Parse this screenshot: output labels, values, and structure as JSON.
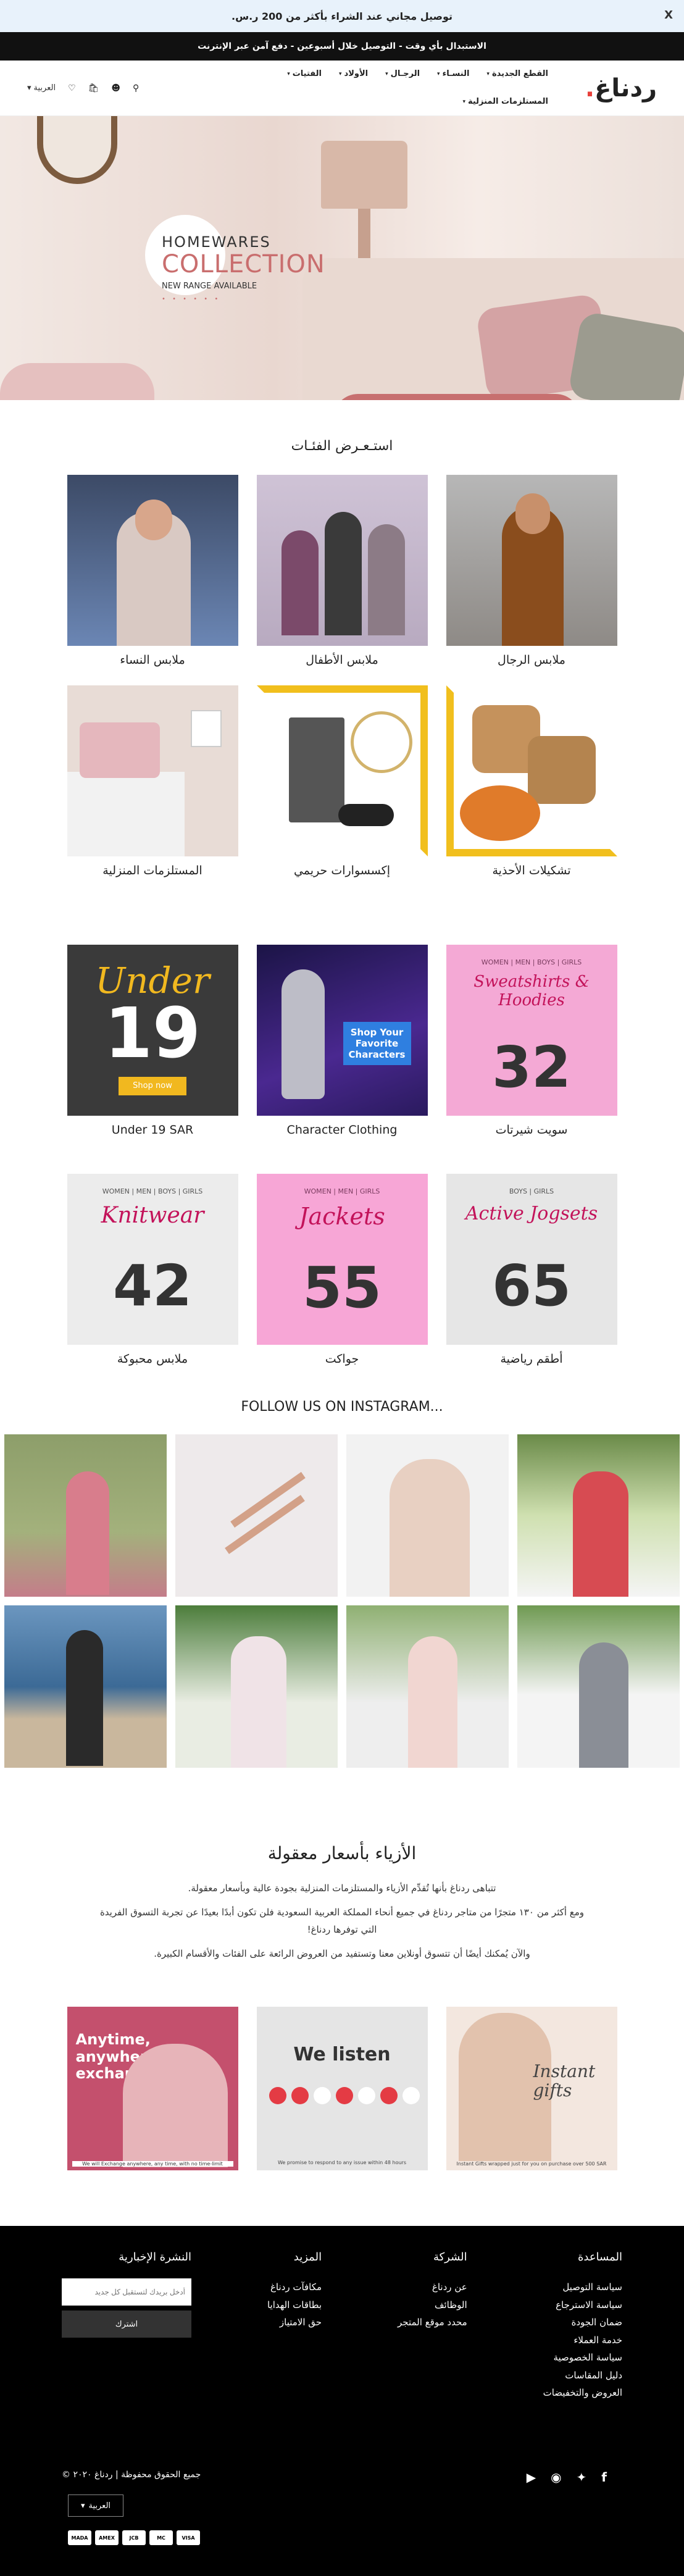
{
  "announcement": {
    "text": "توصيل مجاني عند الشراء بأكثر من 200 ر.س.",
    "close": "X"
  },
  "subbar": {
    "text": "الاستبدال بأي وقت - التوصيل خلال أسبوعين - دفع آمن عبر الإنترنت"
  },
  "header": {
    "logo": "ردناغ",
    "logo_dot": ".",
    "lang": "العربية",
    "nav": [
      {
        "label": "القطع الجديدة"
      },
      {
        "label": "النسـاء"
      },
      {
        "label": "الرجـال"
      },
      {
        "label": "الأولاد"
      },
      {
        "label": "الفتيات"
      },
      {
        "label": "المستلزمات المنزلية"
      }
    ]
  },
  "hero": {
    "line1": "HOMEWARES",
    "line2": "COLLECTION",
    "line3": "NEW RANGE AVAILABLE",
    "dots": "• • • • • •"
  },
  "categories": {
    "title": "استـعـرض الفئـات",
    "items": [
      {
        "label": "ملابس الرجال"
      },
      {
        "label": "ملابس الأطفال"
      },
      {
        "label": "ملابس النساء"
      },
      {
        "label": "تشكيلات الأحذية"
      },
      {
        "label": "إكسسوارات حريمي"
      },
      {
        "label": "المستلزمات المنزلية"
      }
    ]
  },
  "promos": {
    "items": [
      {
        "label": "سويت شيرتات",
        "script": "Sweatshirts & Hoodies",
        "tag": "WOMEN | MEN | BOYS | GIRLS",
        "price": "32",
        "bg": "#f4a9d5"
      },
      {
        "label": "Character Clothing",
        "script": "Shop Your Favorite Characters",
        "tag": "",
        "price": "",
        "bg": "#3b2070"
      },
      {
        "label": "Under 19 SAR",
        "script": "Under",
        "tag": "",
        "price": "19",
        "btn": "Shop now",
        "bg": "#3a3a3a"
      },
      {
        "label": "أطقم رياضية",
        "script": "Active Jogsets",
        "tag": "BOYS | GIRLS",
        "price": "65",
        "bg": "#e6e6e6"
      },
      {
        "label": "جواكت",
        "script": "Jackets",
        "tag": "WOMEN | MEN | GIRLS",
        "price": "55",
        "bg": "#f7a6d6"
      },
      {
        "label": "ملابس محبوكة",
        "script": "Knitwear",
        "tag": "WOMEN | MEN | BOYS | GIRLS",
        "price": "42",
        "bg": "#ececec"
      }
    ]
  },
  "instagram": {
    "title": "FOLLOW US ON INSTAGRAM..."
  },
  "about": {
    "title": "الأزياء بأسعار معقولة",
    "p1": "تتباهى ردناغ بأنها تُقدِّم الأزياء والمستلزمات المنزلية بجودة عالية وبأسعار معقولة.",
    "p2": "ومع أكثر من ١٣٠ متجرًا من متاجر ردناغ في جميع أنحاء المملكة العربية السعودية فلن تكون أبدًا بعيدًا عن تجربة التسوق الفريدة التي توفرها ردناغ!",
    "p3": "والآن يُمكنك أيضًا أن تتسوق أونلاين معنا وتستفيد من العروض الرائعة على الفئات والأقسام الكبيرة."
  },
  "service_cards": [
    {
      "title": "Instant gifts",
      "sub": "Instant Gifts wrapped just for you on purchase over 500 SAR",
      "bg": "#f3e7df"
    },
    {
      "title": "We listen",
      "sub": "We promise to respond to any issue within 48 hours",
      "bg": "#e5e5e5"
    },
    {
      "title": "Anytime, anywhere exchange",
      "sub": "We will Exchange anywhere, any time, with no time-limit",
      "bg": "#c4506d"
    }
  ],
  "footer": {
    "cols": [
      {
        "title": "المساعدة",
        "items": [
          "سياسة التوصيل",
          "سياسة الاسترجاع",
          "ضمان الجودة",
          "خدمة العملاء",
          "سياسة الخصوصية",
          "دليل المقاسات",
          "العروض والتخفيضات"
        ]
      },
      {
        "title": "الشركة",
        "items": [
          "عن ردناغ",
          "الوظائف",
          "محدد موقع المتجر"
        ]
      },
      {
        "title": "المزيد",
        "items": [
          "مكافآت ردناغ",
          "بطاقات الهدايا",
          "حق الامتياز"
        ]
      }
    ],
    "newsletter": {
      "title": "النشرة الإخبارية",
      "placeholder": "أدخل بريدك لتستقبل كل جديد",
      "button": "اشترك"
    },
    "copyright": "جميع الحقوق محفوظة | ردناغ ٢٠٢٠ ©",
    "lang": "العربية",
    "payments": [
      "MADA",
      "AMEX",
      "JCB",
      "MC",
      "VISA"
    ]
  }
}
